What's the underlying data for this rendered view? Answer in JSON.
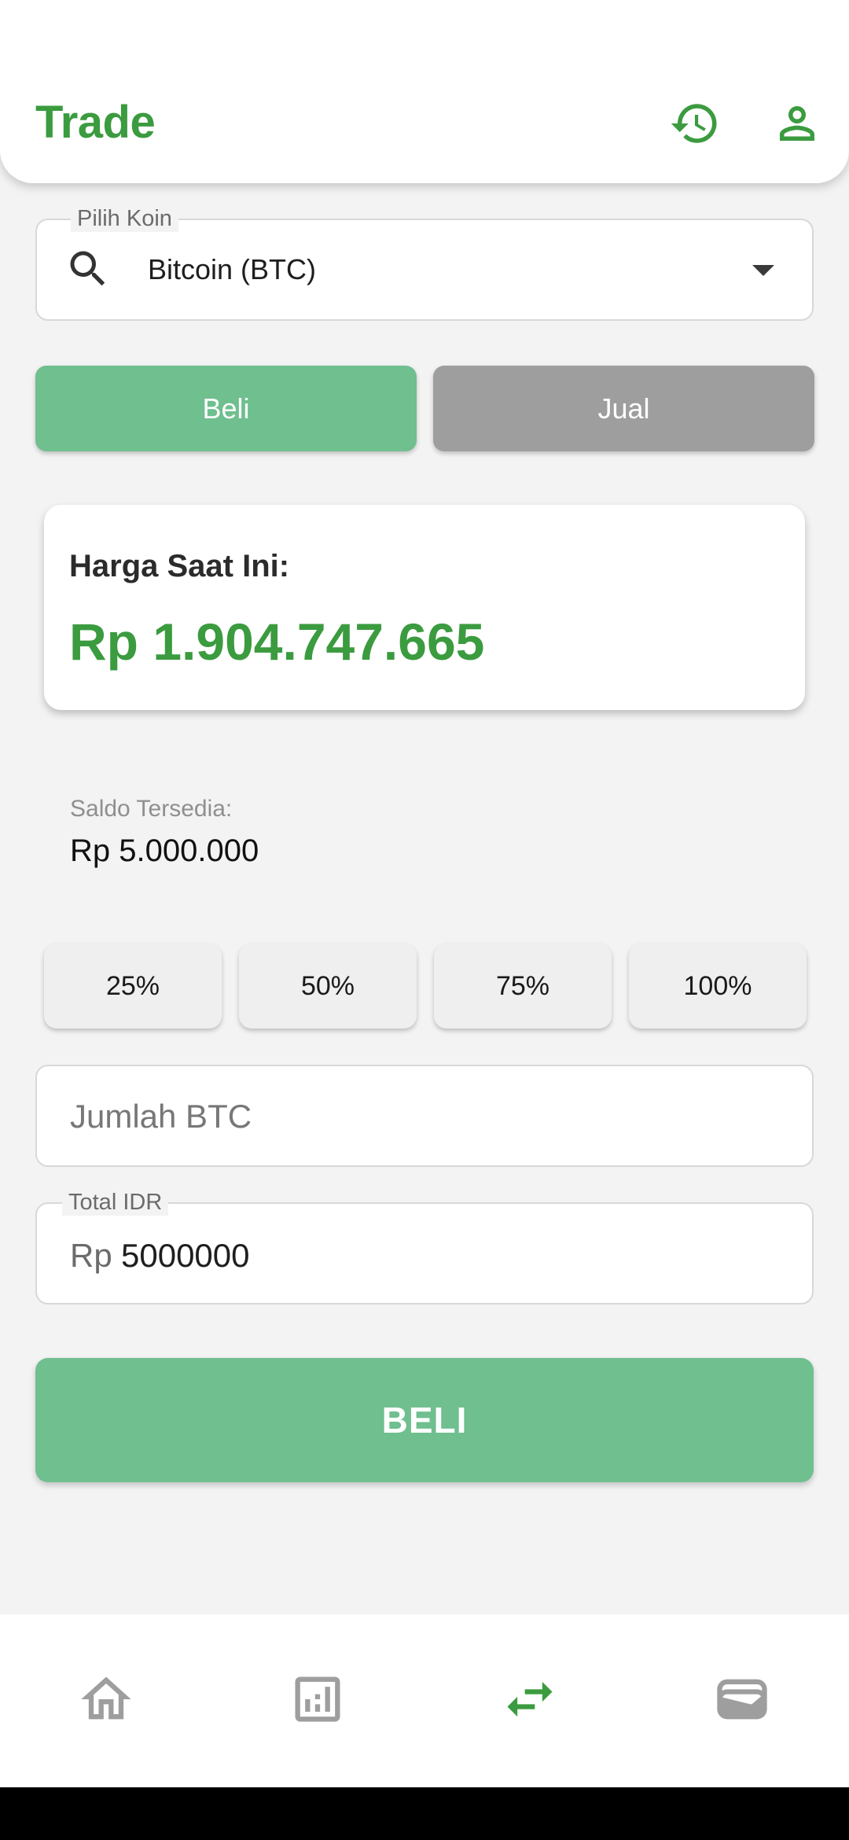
{
  "appbar": {
    "title": "Trade",
    "history_icon": "history-icon",
    "profile_icon": "person-icon"
  },
  "coin_select": {
    "label": "Pilih Koin",
    "value": "Bitcoin (BTC)",
    "icon": "search-icon"
  },
  "mode_tabs": {
    "buy": "Beli",
    "sell": "Jual",
    "selected": "Beli"
  },
  "price_card": {
    "label": "Harga Saat Ini:",
    "value": "Rp 1.904.747.665"
  },
  "balance": {
    "label": "Saldo Tersedia:",
    "value": "Rp 5.000.000"
  },
  "percent_buttons": [
    "25%",
    "50%",
    "75%",
    "100%"
  ],
  "amount_field": {
    "placeholder": "Jumlah BTC",
    "value": ""
  },
  "total_field": {
    "label": "Total IDR",
    "prefix": "Rp",
    "value": "5000000"
  },
  "submit": {
    "label": "BELI"
  },
  "bottom_nav": {
    "items": [
      {
        "icon": "home-icon",
        "active": false
      },
      {
        "icon": "chart-icon",
        "active": false
      },
      {
        "icon": "swap-icon",
        "active": true
      },
      {
        "icon": "wallet-icon",
        "active": false
      }
    ]
  },
  "colors": {
    "accent": "#3b9b3f",
    "buy_button": "#6fbf8f",
    "sell_button": "#9e9e9e",
    "nav_inactive": "#9e9e9e",
    "background": "#f3f3f3"
  }
}
